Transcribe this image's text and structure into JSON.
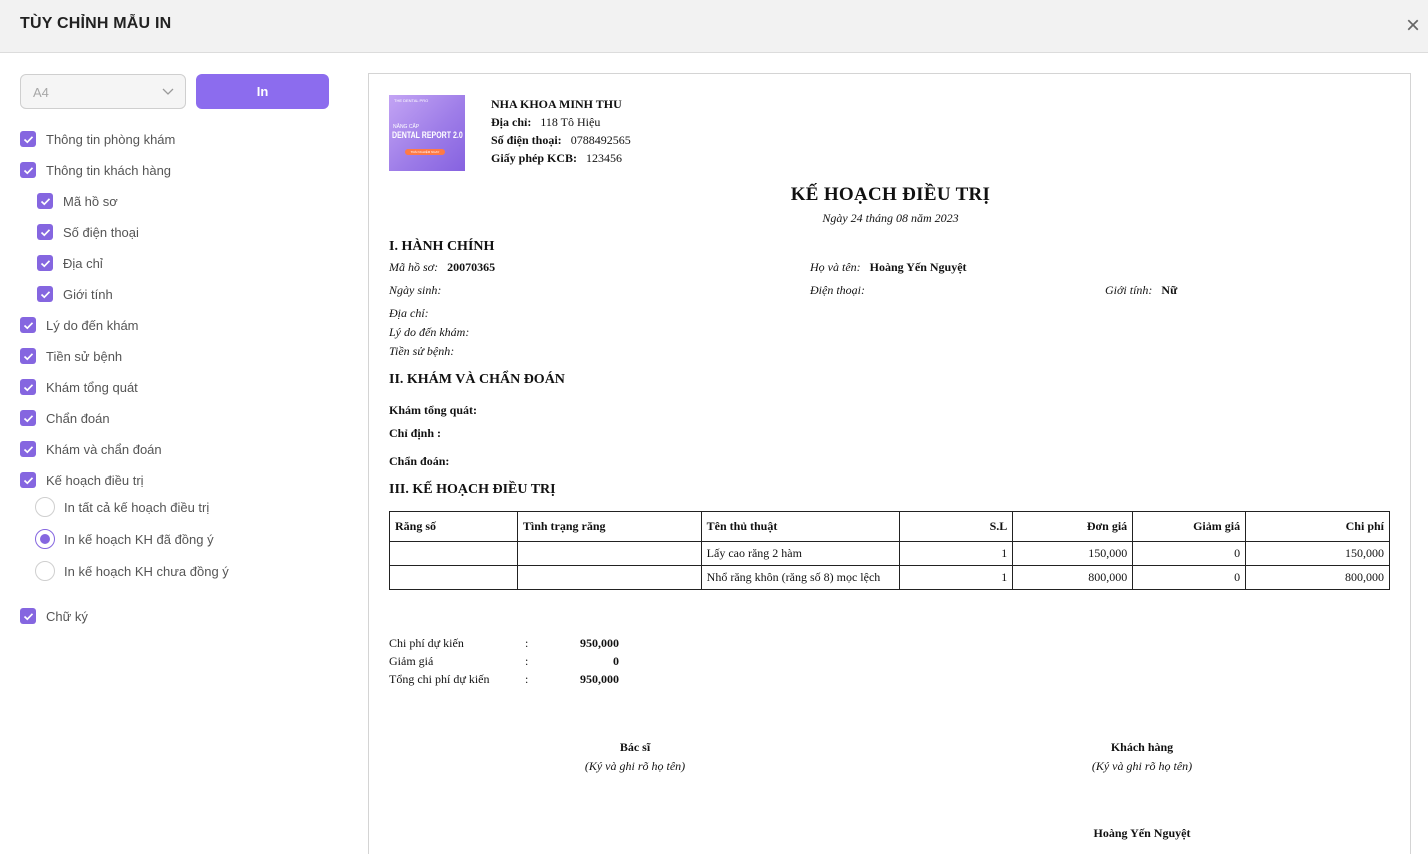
{
  "header": {
    "title": "TÙY CHỈNH MẪU IN"
  },
  "controls": {
    "paper_size": "A4",
    "print_label": "In"
  },
  "options": {
    "clinic_info": "Thông tin phòng khám",
    "customer_info": "Thông tin khách hàng",
    "record_code": "Mã hồ sơ",
    "phone": "Số điện thoại",
    "address": "Địa chỉ",
    "gender": "Giới tính",
    "visit_reason": "Lý do đến khám",
    "medical_history": "Tiền sử bệnh",
    "general_exam": "Khám tổng quát",
    "diagnosis": "Chẩn đoán",
    "exam_and_diagnosis": "Khám và chẩn đoán",
    "treatment_plan": "Kế hoạch điều trị",
    "plan_all": "In tất cả kế hoạch điều trị",
    "plan_agreed": "In kế hoạch KH đã đồng ý",
    "plan_not_agreed": "In kế hoạch KH chưa đồng ý",
    "signature": "Chữ ký",
    "selected_plan_option": "plan_agreed"
  },
  "document": {
    "logo": {
      "line1": "THE DENTAL PRO",
      "line2": "NÂNG CẤP",
      "line3": "DENTAL REPORT 2.0",
      "line4": "TRẢI NGHIỆM NGAY"
    },
    "clinic_name": "NHA KHOA MINH THU",
    "address_label": "Địa chỉ:",
    "address": "118 Tô Hiệu",
    "phone_label": "Số điện thoại:",
    "phone": "0788492565",
    "license_label": "Giấy phép KCB:",
    "license": "123456",
    "title": "KẾ HOẠCH ĐIỀU TRỊ",
    "date": "Ngày 24 tháng 08 năm 2023",
    "section1": "I. HÀNH CHÍNH",
    "record_label": "Mã hồ sơ:",
    "record_value": "20070365",
    "name_label": "Họ và tên:",
    "name_value": "Hoàng Yến Nguyệt",
    "dob_label": "Ngày sinh:",
    "phone2_label": "Điện thoại:",
    "gender_label": "Giới tính:",
    "gender_value": "Nữ",
    "address2_label": "Địa chỉ:",
    "reason_label": "Lý do đến khám:",
    "history_label": "Tiền sử bệnh:",
    "section2": "II. KHÁM VÀ CHẨN ĐOÁN",
    "general_label": "Khám tổng quát:",
    "indication_label": "Chỉ định :",
    "diagnosis_label": "Chẩn đoán:",
    "section3": "III. KẾ HOẠCH ĐIỀU TRỊ",
    "table_headers": [
      "Răng số",
      "Tình trạng răng",
      "Tên thủ thuật",
      "S.L",
      "Đơn giá",
      "Giảm giá",
      "Chi phí"
    ],
    "table_rows": [
      [
        "",
        "",
        "Lấy cao răng 2 hàm",
        "1",
        "150,000",
        "0",
        "150,000"
      ],
      [
        "",
        "",
        "Nhổ răng khôn (răng số 8) mọc lệch",
        "1",
        "800,000",
        "0",
        "800,000"
      ]
    ],
    "summary": {
      "expected_label": "Chi phí dự kiến",
      "expected_value": "950,000",
      "discount_label": "Giảm giá",
      "discount_value": "0",
      "total_label": "Tổng chi phí dự kiến",
      "total_value": "950,000",
      "colon": ":"
    },
    "signatures": {
      "doctor": "Bác sĩ",
      "customer": "Khách hàng",
      "hint": "(Ký và ghi rõ họ tên)",
      "customer_name": "Hoàng Yến Nguyệt"
    }
  },
  "colors": {
    "accent": "#8c6cee",
    "checkbox": "#8566e0"
  }
}
